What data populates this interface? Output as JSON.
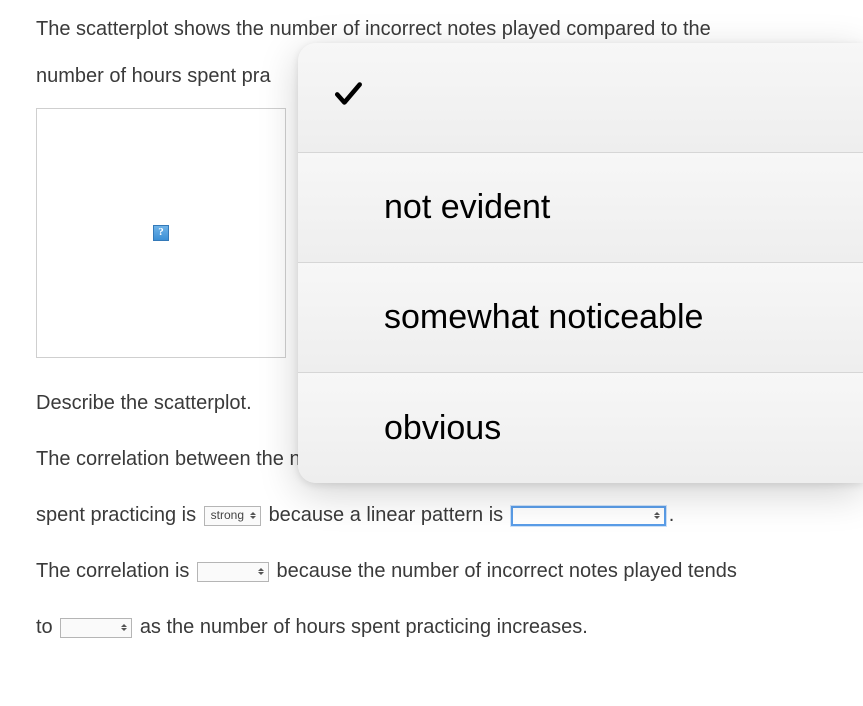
{
  "intro": {
    "line1": "The scatterplot shows the number of incorrect notes played compared to the",
    "line2_prefix": "number of hours spent pra"
  },
  "image_placeholder": {
    "glyph": "?"
  },
  "describe_heading": "Describe the scatterplot.",
  "sentence1": {
    "part1": "The correlation between the number of incorrect notes played and the number of",
    "part2": "hours spent practicing is",
    "select1_value": "strong",
    "part3": "because a linear pattern is",
    "select2_value": "",
    "period": "."
  },
  "sentence2": {
    "part1": "The correlation is",
    "select1_value": "",
    "part2": "because the number of incorrect notes played tends",
    "part3": "to",
    "select2_value": "",
    "part4": "as the number of hours spent practicing increases."
  },
  "dropdown": {
    "options": [
      {
        "label": "",
        "selected": true
      },
      {
        "label": "not evident",
        "selected": false
      },
      {
        "label": "somewhat noticeable",
        "selected": false
      },
      {
        "label": "obvious",
        "selected": false
      }
    ]
  }
}
